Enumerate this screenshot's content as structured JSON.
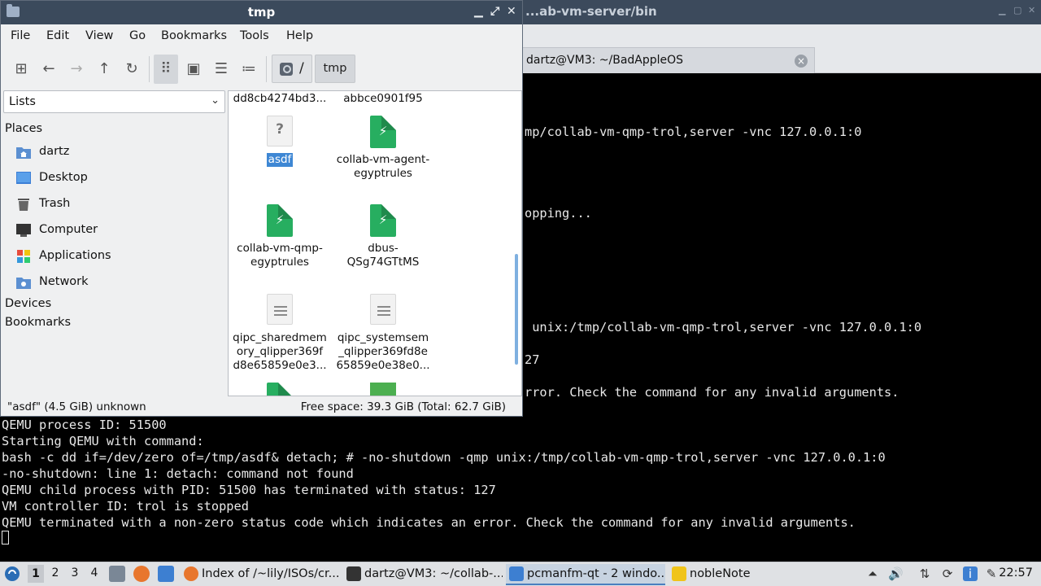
{
  "terminal": {
    "window_title": "...ab-vm-server/bin",
    "tab_label": "dartz@VM3: ~/BadAppleOS",
    "partial_lines": [
      "mp/collab-vm-qmp-trol,server -vnc 127.0.0.1:0",
      "opping...",
      " unix:/tmp/collab-vm-qmp-trol,server -vnc 127.0.0.1:0",
      "27",
      "rror. Check the command for any invalid arguments."
    ],
    "lines": [
      "QEMU process ID: 51500",
      "Starting QEMU with command:",
      "bash -c dd if=/dev/zero of=/tmp/asdf& detach; # -no-shutdown -qmp unix:/tmp/collab-vm-qmp-trol,server -vnc 127.0.0.1:0",
      "-no-shutdown: line 1: detach: command not found",
      "QEMU child process with PID: 51500 has terminated with status: 127",
      "VM controller ID: trol is stopped",
      "QEMU terminated with a non-zero status code which indicates an error. Check the command for any invalid arguments."
    ]
  },
  "file_manager": {
    "title": "tmp",
    "menu": [
      "File",
      "Edit",
      "View",
      "Go",
      "Bookmarks",
      "Tools",
      "Help"
    ],
    "breadcrumb": {
      "root": "/",
      "current": "tmp"
    },
    "side_pane_mode": "Lists",
    "sidebar": {
      "places_header": "Places",
      "places": [
        {
          "label": "dartz",
          "icon": "home-folder-icon"
        },
        {
          "label": "Desktop",
          "icon": "desktop-icon"
        },
        {
          "label": "Trash",
          "icon": "trash-icon"
        },
        {
          "label": "Computer",
          "icon": "computer-icon"
        },
        {
          "label": "Applications",
          "icon": "applications-icon"
        },
        {
          "label": "Network",
          "icon": "network-icon"
        }
      ],
      "devices_header": "Devices",
      "bookmarks_header": "Bookmarks"
    },
    "files_top_partial": [
      "dd8cb4274bd3...",
      "abbce0901f95"
    ],
    "files": [
      {
        "name": "asdf",
        "icon": "unknown-file-icon",
        "selected": true
      },
      {
        "name": "collab-vm-agent-egyptrules",
        "line1": "collab-vm-agent-",
        "line2": "egyptrules",
        "icon": "socket-file-icon"
      },
      {
        "line1": "collab-vm-qmp-",
        "line2": "egyptrules",
        "icon": "socket-file-icon"
      },
      {
        "line1": "dbus-",
        "line2": "QSg74GTtMS",
        "icon": "socket-file-icon"
      },
      {
        "line1": "qipc_sharedmem",
        "line2": "ory_qlipper369f",
        "line3": "d8e65859e0e3...",
        "icon": "text-file-icon"
      },
      {
        "line1": "qipc_systemsem",
        "line2": "_qlipper369fd8e",
        "line3": "65859e0e38e0...",
        "icon": "text-file-icon"
      }
    ],
    "status_left": "\"asdf\" (4.5 GiB) unknown",
    "status_right": "Free space: 39.3 GiB (Total: 62.7 GiB)"
  },
  "taskbar": {
    "workspaces": [
      "1",
      "2",
      "3",
      "4"
    ],
    "active_workspace": "1",
    "tasks": [
      {
        "label": "Index of /~lily/ISOs/cr...",
        "icon": "firefox-icon"
      },
      {
        "label": "dartz@VM3: ~/collab-...",
        "icon": "terminal-icon"
      },
      {
        "label": "pcmanfm-qt - 2 windo...",
        "icon": "folder-icon"
      },
      {
        "label": "nobleNote",
        "icon": "notes-icon"
      }
    ],
    "clock": "22:57"
  },
  "colors": {
    "selection": "#3e87d4",
    "titlebar": "#3b4a5c",
    "socket": "#27ae60"
  }
}
